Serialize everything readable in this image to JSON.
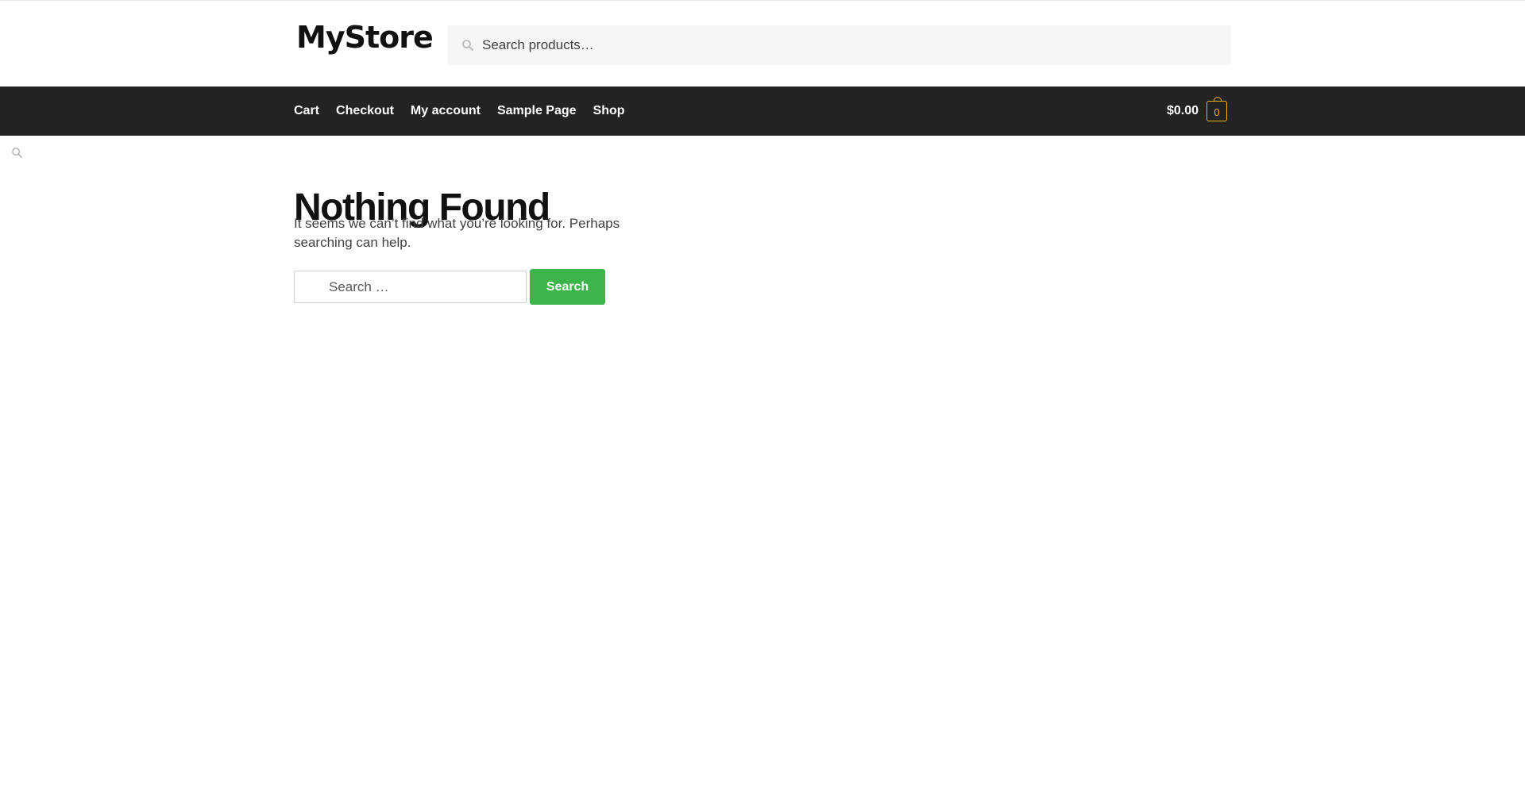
{
  "header": {
    "logo_text": "MyStore",
    "product_search": {
      "placeholder": "Search products…",
      "value": ""
    }
  },
  "nav": {
    "items": [
      {
        "label": "Cart"
      },
      {
        "label": "Checkout"
      },
      {
        "label": "My account"
      },
      {
        "label": "Sample Page"
      },
      {
        "label": "Shop"
      }
    ],
    "cart": {
      "amount": "$0.00",
      "count": "0"
    }
  },
  "main": {
    "title": "Nothing Found",
    "message": "It seems we can’t find what you’re looking for. Perhaps searching can help.",
    "search": {
      "placeholder": "Search …",
      "value": "",
      "button_label": "Search"
    }
  },
  "colors": {
    "nav_background": "#232323",
    "accent_button": "#3bb54a",
    "cart_badge": "#f2b01e"
  },
  "icons": {
    "header_search": "search-icon",
    "stray_search": "search-icon",
    "cart_badge": "cart-bag-icon"
  }
}
